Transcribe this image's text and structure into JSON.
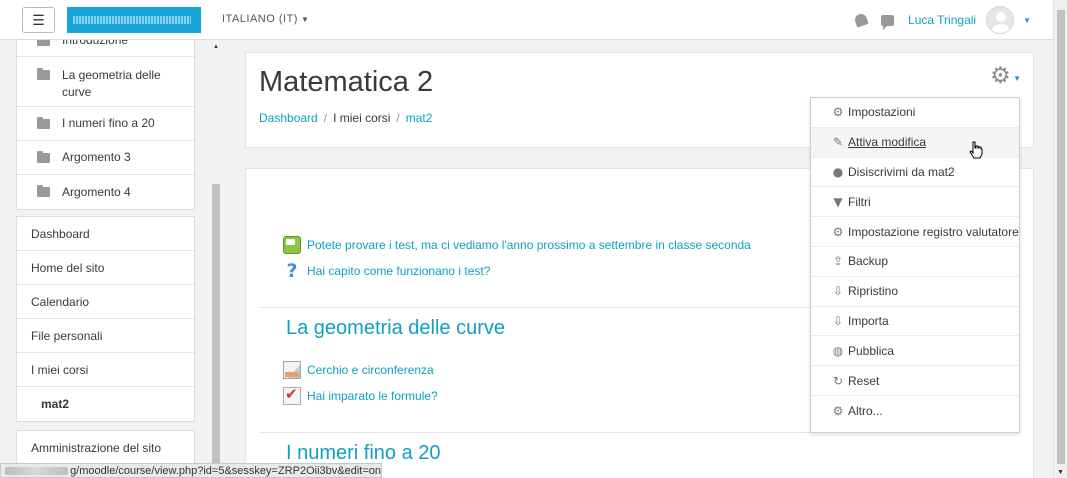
{
  "navbar": {
    "menu_glyph": "☰",
    "language": "ITALIANO (IT)",
    "language_caret": "▼",
    "user_name": "Luca Tringali",
    "user_caret": "▼"
  },
  "drawer": {
    "course_items": [
      {
        "label": "Introduzione"
      },
      {
        "label": "La geometria delle curve"
      },
      {
        "label": "I numeri fino a 20"
      },
      {
        "label": "Argomento 3"
      },
      {
        "label": "Argomento 4"
      }
    ],
    "nav_items": [
      {
        "label": "Dashboard"
      },
      {
        "label": "Home del sito"
      },
      {
        "label": "Calendario"
      },
      {
        "label": "File personali"
      },
      {
        "label": "I miei corsi"
      },
      {
        "label": "mat2"
      }
    ],
    "admin_label": "Amministrazione del sito"
  },
  "header": {
    "title": "Matematica 2",
    "breadcrumb": [
      "Dashboard",
      "I miei corsi",
      "mat2"
    ],
    "breadcrumb_sep": "/",
    "gear_caret": "▼"
  },
  "content": {
    "activities_top": [
      {
        "label": "Potete provare i test, ma ci vediamo l'anno prossimo a settembre in classe seconda",
        "icon": "forum-icon"
      },
      {
        "label": "Hai capito come funzionano i test?",
        "icon": "question-icon"
      }
    ],
    "section1": {
      "title": "La geometria delle curve",
      "activities": [
        {
          "label": "Cerchio e circonferenza",
          "icon": "page-icon"
        },
        {
          "label": "Hai imparato le formule?",
          "icon": "quiz-icon"
        }
      ]
    },
    "section2": {
      "title": "I numeri fino a 20"
    }
  },
  "dropdown": {
    "items": [
      {
        "label": "Impostazioni",
        "icon": "⚙"
      },
      {
        "label": "Attiva modifica",
        "icon": "✎"
      },
      {
        "label": "Disiscrivimi da mat2",
        "icon": "●"
      },
      {
        "label": "Filtri",
        "icon": "▼"
      },
      {
        "label": "Impostazione registro valutatore",
        "icon": "⚙"
      },
      {
        "label": "Backup",
        "icon": "⇪"
      },
      {
        "label": "Ripristino",
        "icon": "⇩"
      },
      {
        "label": "Importa",
        "icon": "⇩"
      },
      {
        "label": "Pubblica",
        "icon": "◍"
      },
      {
        "label": "Reset",
        "icon": "↻"
      },
      {
        "label": "Altro...",
        "icon": "⚙"
      }
    ]
  },
  "statusbar": {
    "url": "g/moodle/course/view.php?id=5&sesskey=ZRP2Oii3bv&edit=on"
  },
  "colors": {
    "link": "#0f9fc5",
    "logo_bg": "#1aa3d6"
  }
}
